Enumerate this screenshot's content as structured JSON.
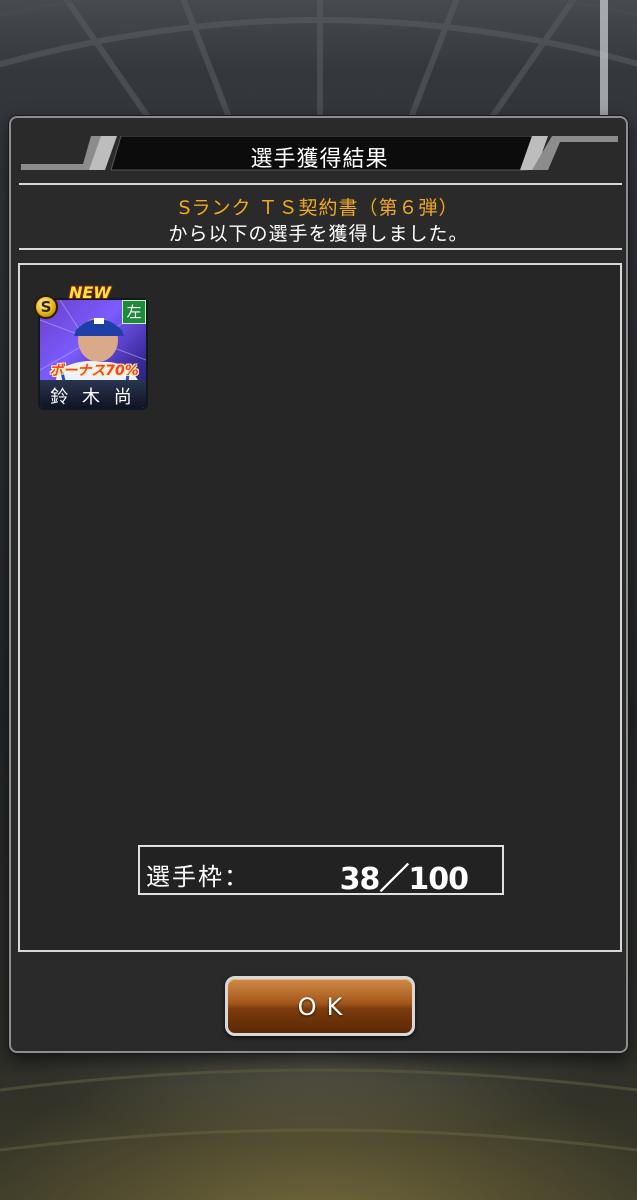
{
  "dialog": {
    "title": "選手獲得結果",
    "source_item": "Sランク ＴＳ契約書（第６弾）",
    "message": "から以下の選手を獲得しました。"
  },
  "player_card": {
    "new_badge": "NEW",
    "rank": "S",
    "hand": "左",
    "bonus": "ボーナス70%",
    "name": "鈴 木 尚"
  },
  "roster": {
    "label": "選手枠：",
    "value": "38／100"
  },
  "ok_button": {
    "label": "OK"
  },
  "colors": {
    "accent_orange": "#f0a820",
    "button_brown": "#a4571b",
    "dialog_bg": "#2a2a2a"
  }
}
